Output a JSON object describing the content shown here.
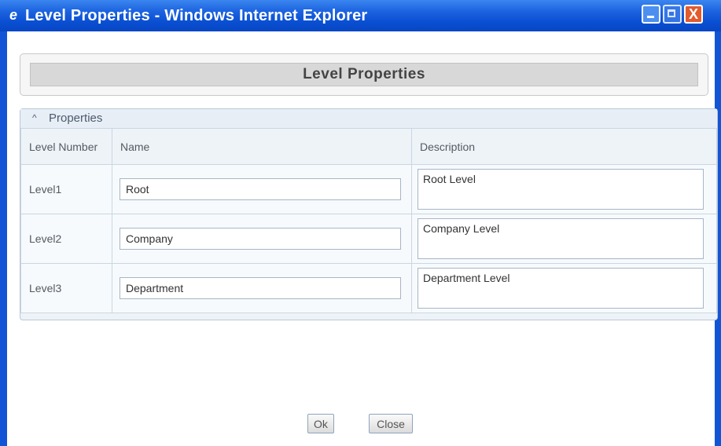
{
  "window": {
    "title": "Level Properties - Windows Internet Explorer",
    "icon": "ie-logo-icon",
    "controls": [
      "minimize-icon",
      "maximize-icon",
      "close-icon"
    ],
    "close_glyph": "X"
  },
  "dialog": {
    "title": "Level Properties",
    "section": {
      "title": "Properties",
      "collapse_icon": "collapse-up-icon",
      "collapse_glyph": "^",
      "columns": {
        "level_number": "Level Number",
        "name": "Name",
        "description": "Description"
      },
      "rows": [
        {
          "level": "Level1",
          "name": "Root",
          "description": "Root Level"
        },
        {
          "level": "Level2",
          "name": "Company",
          "description": "Company Level"
        },
        {
          "level": "Level3",
          "name": "Department",
          "description": "Department Level"
        }
      ]
    },
    "buttons": {
      "ok": "Ok",
      "close": "Close"
    }
  },
  "colors": {
    "titlebar": "#0a4fd2",
    "panel_header": "#e7eef6",
    "panel_bg": "#eef3f8"
  }
}
